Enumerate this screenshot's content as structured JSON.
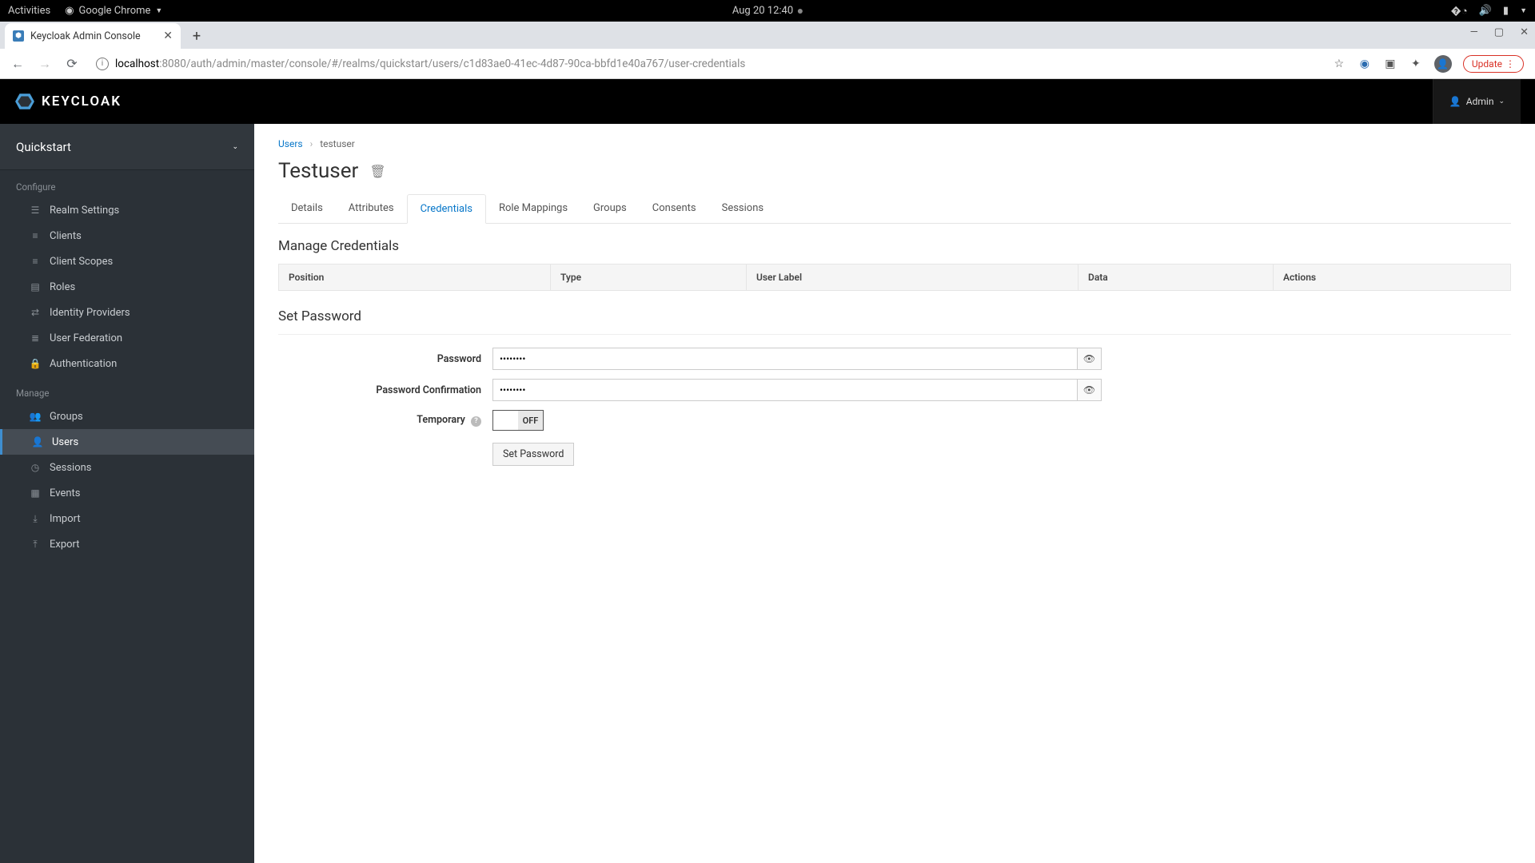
{
  "gnome": {
    "activities": "Activities",
    "app": "Google Chrome",
    "datetime": "Aug 20  12:40"
  },
  "browser": {
    "tab_title": "Keycloak Admin Console",
    "url_host": "localhost",
    "url_rest": ":8080/auth/admin/master/console/#/realms/quickstart/users/c1d83ae0-41ec-4d87-90ca-bbfd1e40a767/user-credentials",
    "update_label": "Update"
  },
  "header": {
    "logo_text": "KEYCLOAK",
    "user_label": "Admin"
  },
  "sidebar": {
    "realm": "Quickstart",
    "section_configure": "Configure",
    "section_manage": "Manage",
    "configure": [
      {
        "label": "Realm Settings"
      },
      {
        "label": "Clients"
      },
      {
        "label": "Client Scopes"
      },
      {
        "label": "Roles"
      },
      {
        "label": "Identity Providers"
      },
      {
        "label": "User Federation"
      },
      {
        "label": "Authentication"
      }
    ],
    "manage": [
      {
        "label": "Groups"
      },
      {
        "label": "Users"
      },
      {
        "label": "Sessions"
      },
      {
        "label": "Events"
      },
      {
        "label": "Import"
      },
      {
        "label": "Export"
      }
    ]
  },
  "breadcrumb": {
    "parent": "Users",
    "current": "testuser"
  },
  "page": {
    "title": "Testuser"
  },
  "tabs": [
    {
      "label": "Details"
    },
    {
      "label": "Attributes"
    },
    {
      "label": "Credentials"
    },
    {
      "label": "Role Mappings"
    },
    {
      "label": "Groups"
    },
    {
      "label": "Consents"
    },
    {
      "label": "Sessions"
    }
  ],
  "credentials": {
    "manage_heading": "Manage Credentials",
    "columns": {
      "position": "Position",
      "type": "Type",
      "user_label": "User Label",
      "data": "Data",
      "actions": "Actions"
    }
  },
  "set_password": {
    "heading": "Set Password",
    "password_label": "Password",
    "password_value": "••••••••",
    "confirm_label": "Password Confirmation",
    "confirm_value": "••••••••",
    "temporary_label": "Temporary",
    "toggle_state": "OFF",
    "button_label": "Set Password"
  }
}
